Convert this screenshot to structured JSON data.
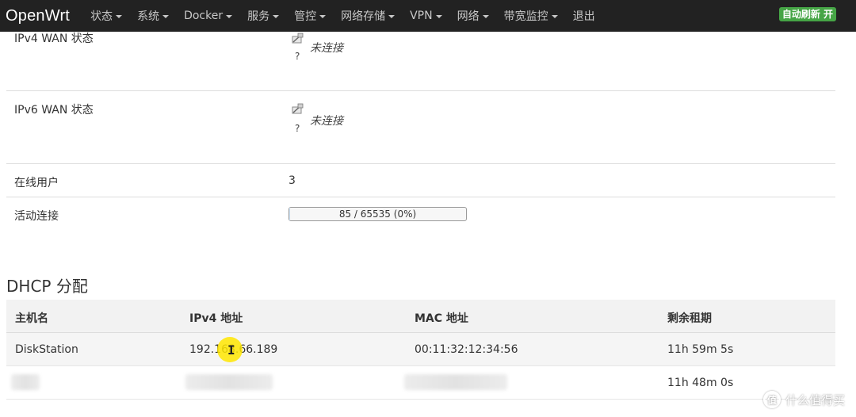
{
  "navbar": {
    "brand": "OpenWrt",
    "menu": [
      {
        "label": "状态",
        "dropdown": true
      },
      {
        "label": "系统",
        "dropdown": true
      },
      {
        "label": "Docker",
        "dropdown": true
      },
      {
        "label": "服务",
        "dropdown": true
      },
      {
        "label": "管控",
        "dropdown": true
      },
      {
        "label": "网络存储",
        "dropdown": true
      },
      {
        "label": "VPN",
        "dropdown": true
      },
      {
        "label": "网络",
        "dropdown": true
      },
      {
        "label": "带宽监控",
        "dropdown": true
      },
      {
        "label": "退出",
        "dropdown": false
      }
    ],
    "auto_refresh": "自动刷新 开",
    "accent_color": "#46a546"
  },
  "status": {
    "ipv4_wan": {
      "label": "IPv4 WAN 状态",
      "icon_symbol": "?",
      "state": "未连接"
    },
    "ipv6_wan": {
      "label": "IPv6 WAN 状态",
      "icon_symbol": "?",
      "state": "未连接"
    },
    "online_users": {
      "label": "在线用户",
      "value": "3"
    },
    "active_connections": {
      "label": "活动连接",
      "text": "85 / 65535 (0%)",
      "fill_fraction": 0.0013
    }
  },
  "dhcp": {
    "title": "DHCP 分配",
    "headers": [
      "主机名",
      "IPv4 地址",
      "MAC 地址",
      "剩余租期"
    ],
    "rows": [
      {
        "hostname": "DiskStation",
        "ipv4": "192.168.66.189",
        "mac": "00:11:32:12:34:56",
        "lease": "11h 59m 5s"
      },
      {
        "hostname": "",
        "ipv4": "",
        "mac": "",
        "lease": "11h 48m 0s"
      }
    ]
  },
  "watermark": {
    "text": "什么值得买",
    "icon_text": "值"
  }
}
